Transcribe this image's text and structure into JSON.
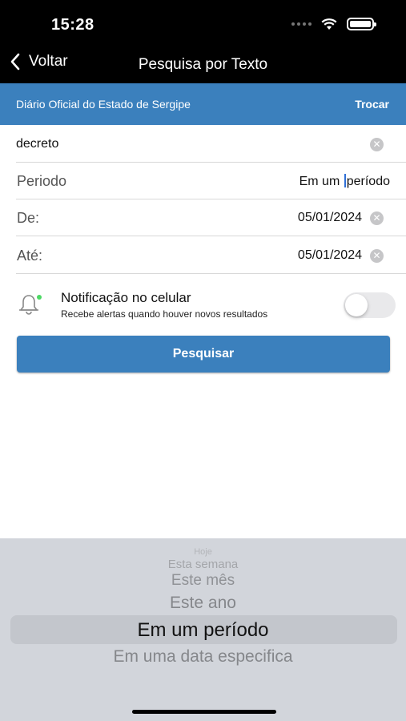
{
  "status_bar": {
    "time": "15:28"
  },
  "nav": {
    "back_label": "Voltar",
    "title": "Pesquisa por Texto"
  },
  "source": {
    "name": "Diário Oficial do Estado de Sergipe",
    "change_label": "Trocar"
  },
  "form": {
    "query_value": "decreto",
    "period_label": "Periodo",
    "period_value_before_cursor": "Em um ",
    "period_value_after_cursor": "período",
    "from_label": "De:",
    "from_value": "05/01/2024",
    "to_label": "Até:",
    "to_value": "05/01/2024"
  },
  "notification": {
    "title": "Notificação no celular",
    "subtitle": "Recebe alertas quando houver novos resultados",
    "enabled": false
  },
  "search_button": {
    "label": "Pesquisar"
  },
  "picker": {
    "items": [
      "Hoje",
      "Esta semana",
      "Este mês",
      "Este ano",
      "Em um período",
      "Em uma data especifica"
    ],
    "selected": "Em um período"
  },
  "colors": {
    "brand_blue": "#3b80bd",
    "topbar": "#000000",
    "picker_bg": "#d2d5db"
  },
  "icons": {
    "back": "chevron-left-icon",
    "clear": "clear-x-icon",
    "notification": "bell-icon"
  }
}
